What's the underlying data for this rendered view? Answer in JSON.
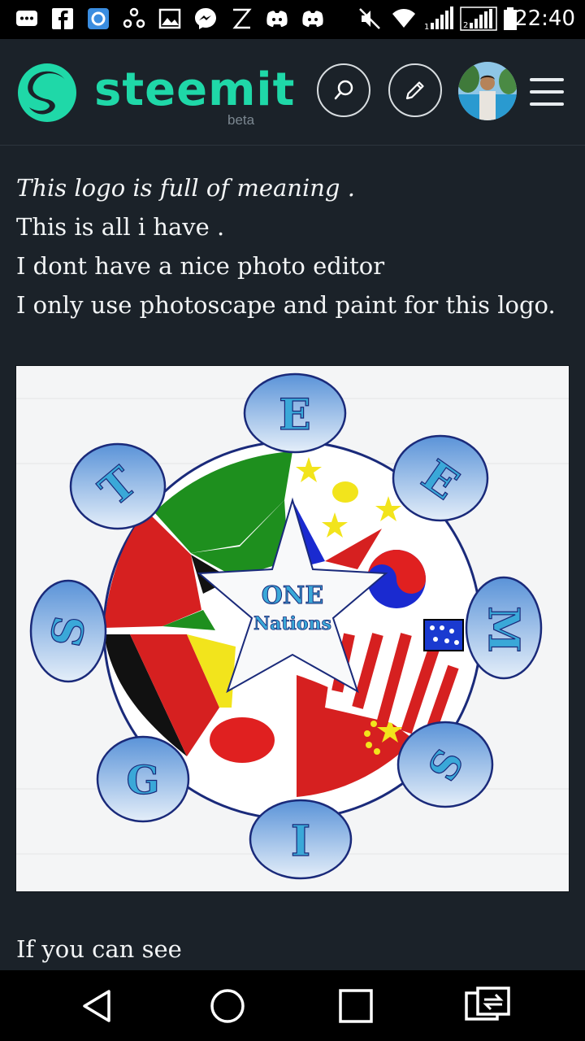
{
  "status_bar": {
    "time": "22:40",
    "left_icons": [
      "messages-icon",
      "facebook-icon",
      "sync-app-icon",
      "share-icon",
      "gallery-icon",
      "messenger-icon",
      "z-app-icon",
      "discord-icon",
      "discord-icon"
    ],
    "right_icons": [
      "mute-icon",
      "wifi-icon",
      "signal-1-icon",
      "signal-2-icon",
      "battery-icon"
    ]
  },
  "header": {
    "brand": "steemit",
    "brand_sub": "beta",
    "accent_color": "#1fd8a8",
    "buttons": [
      "search-icon",
      "edit-icon",
      "avatar",
      "hamburger-menu-icon"
    ]
  },
  "post": {
    "paragraph_1": [
      {
        "text": "This logo is full of meaning .",
        "italic": true
      },
      {
        "text": "This is all i have .",
        "italic": false
      },
      {
        "text": "I dont have a nice photo editor",
        "italic": false
      },
      {
        "text": "I only use photoscape and paint for this logo.",
        "italic": false
      }
    ],
    "figure": {
      "letters": [
        "E",
        "E",
        "M",
        "S",
        "I",
        "G",
        "S",
        "T"
      ],
      "center_line_1": "ONE",
      "center_line_2": "Nations"
    },
    "paragraph_2": "If you can see"
  },
  "nav_bar": {
    "buttons": [
      "back-icon",
      "home-icon",
      "recents-icon",
      "screen-switch-icon"
    ]
  }
}
